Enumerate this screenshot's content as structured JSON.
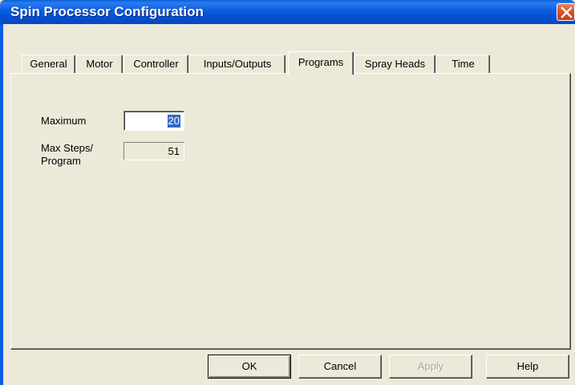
{
  "window": {
    "title": "Spin Processor Configuration",
    "close_icon": "close-icon"
  },
  "tabs": [
    {
      "label": "General"
    },
    {
      "label": "Motor"
    },
    {
      "label": "Controller"
    },
    {
      "label": "Inputs/Outputs"
    },
    {
      "label": "Programs",
      "active": true
    },
    {
      "label": "Spray Heads"
    },
    {
      "label": "Time"
    }
  ],
  "programs": {
    "maximum_label": "Maximum",
    "maximum_value": "20",
    "max_steps_label_line1": "Max Steps/",
    "max_steps_label_line2": "Program",
    "max_steps_value": "51"
  },
  "buttons": {
    "ok": "OK",
    "cancel": "Cancel",
    "apply": "Apply",
    "help": "Help"
  },
  "colors": {
    "titlebar": "#0b5ce0",
    "dialog_face": "#ece9d8",
    "selection": "#316ac5",
    "close_button": "#d8562f"
  }
}
